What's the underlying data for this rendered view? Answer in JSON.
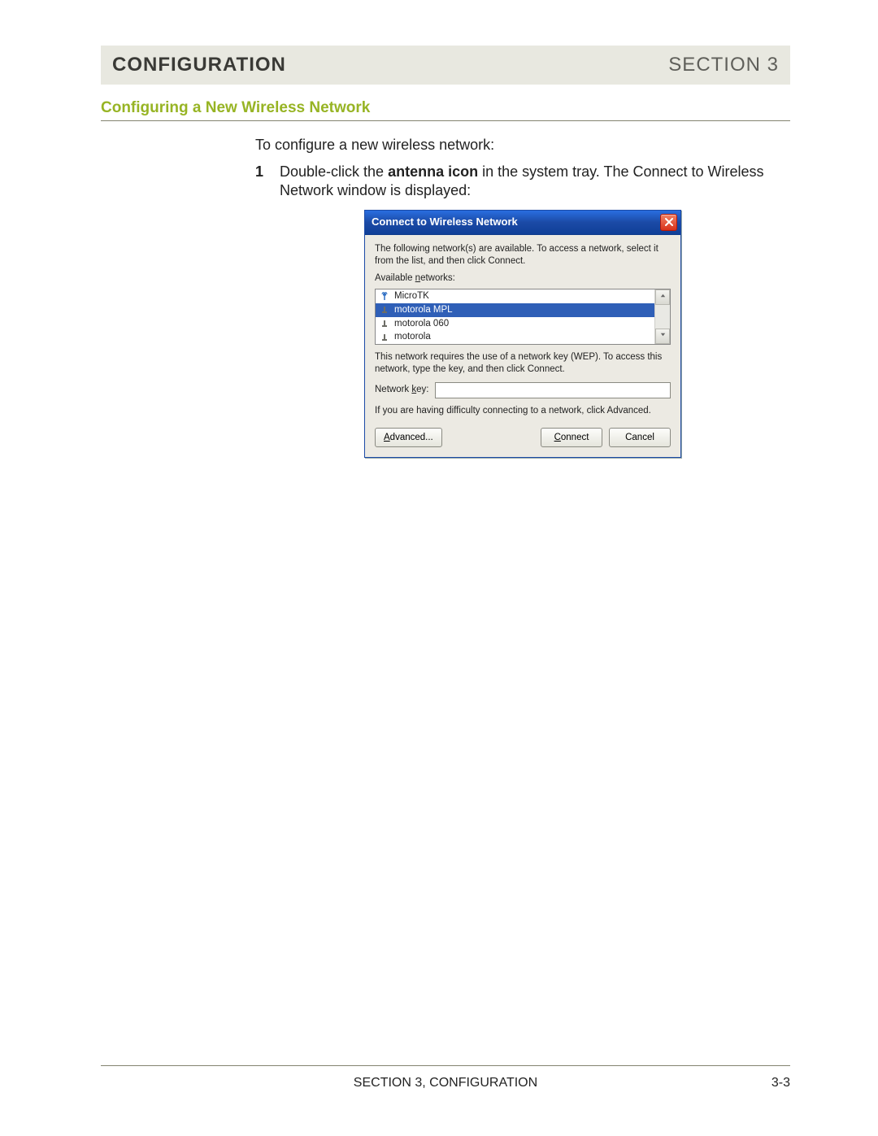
{
  "header": {
    "left": "CONFIGURATION",
    "right": "SECTION 3"
  },
  "subheading": "Configuring a New Wireless Network",
  "intro": "To configure a new wireless network:",
  "step1": {
    "num": "1",
    "pre": "Double-click the ",
    "bold": "antenna icon",
    "post": " in the system tray. The Connect to Wireless Network window is displayed:"
  },
  "dialog": {
    "title": "Connect to Wireless Network",
    "desc": "The following network(s) are available. To access a network, select it from the list, and then click Connect.",
    "available_label_pre": "Available ",
    "available_label_u": "n",
    "available_label_post": "etworks:",
    "networks": [
      {
        "name": "MicroTK",
        "type": "antenna",
        "selected": false
      },
      {
        "name": "motorola MPL",
        "type": "infra",
        "selected": true
      },
      {
        "name": "motorola 060",
        "type": "infra",
        "selected": false
      },
      {
        "name": "motorola",
        "type": "infra",
        "selected": false
      }
    ],
    "wep_text": "This network requires the use of a network key (WEP). To access this network, type the key, and then click Connect.",
    "key_label_pre": "Network ",
    "key_label_u": "k",
    "key_label_post": "ey:",
    "key_value": "",
    "adv_text": "If you are having difficulty connecting to a network, click Advanced.",
    "buttons": {
      "advanced_u": "A",
      "advanced_rest": "dvanced...",
      "connect_u": "C",
      "connect_rest": "onnect",
      "cancel": "Cancel"
    }
  },
  "footer": {
    "center": "SECTION 3, CONFIGURATION",
    "right": "3-3"
  }
}
